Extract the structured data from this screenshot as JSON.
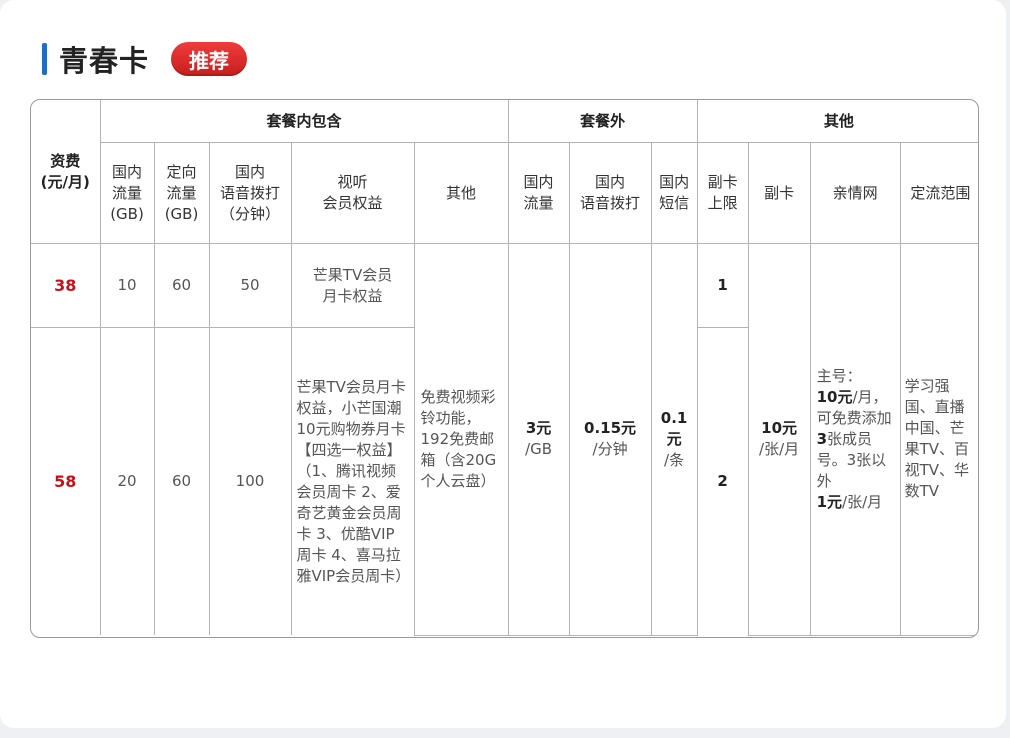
{
  "title": "青春卡",
  "badge": "推荐",
  "headers": {
    "fee": "资费\n(元/月)",
    "group_included": "套餐内包含",
    "group_extra": "套餐外",
    "group_other": "其他",
    "inc_domestic_data": "国内\n流量\n(GB)",
    "inc_targeted_data": "定向\n流量\n(GB)",
    "inc_voice": "国内\n语音拨打\n（分钟）",
    "inc_av": "视听\n会员权益",
    "inc_other": "其他",
    "ex_data": "国内\n流量",
    "ex_voice": "国内\n语音拨打",
    "ex_sms": "国内\n短信",
    "sub_limit": "副卡\n上限",
    "sub_card": "副卡",
    "family": "亲情网",
    "scope": "定流范围"
  },
  "rows": [
    {
      "fee": "38",
      "domestic_data": "10",
      "targeted_data": "60",
      "voice": "50",
      "av": "芒果TV会员\n月卡权益",
      "sub_limit": "1"
    },
    {
      "fee": "58",
      "domestic_data": "20",
      "targeted_data": "60",
      "voice": "100",
      "av": "芒果TV会员月卡权益，小芒国潮10元购物券月卡\n【四选一权益】（1、腾讯视频会员周卡 2、爱奇艺黄金会员周卡 3、优酷VIP周卡 4、喜马拉雅VIP会员周卡）",
      "sub_limit": "2"
    }
  ],
  "shared": {
    "other": "免费视频彩铃功能，192免费邮箱（含20G个人云盘）",
    "ex_data_price": "3元",
    "ex_data_unit": "/GB",
    "ex_voice_price": "0.15元",
    "ex_voice_unit": "/分钟",
    "ex_sms_price": "0.1元",
    "ex_sms_unit": "/条",
    "sub_card_price": "10元",
    "sub_card_unit": "/张/月",
    "family_1": "主号：",
    "family_2a": "10元",
    "family_2b": "/月，可免费添加",
    "family_3a": "3",
    "family_3b": "张成员号。3张以外",
    "family_4a": "1元",
    "family_4b": "/张/月",
    "scope": "学习强国、直播中国、芒果TV、百视TV、华数TV"
  }
}
